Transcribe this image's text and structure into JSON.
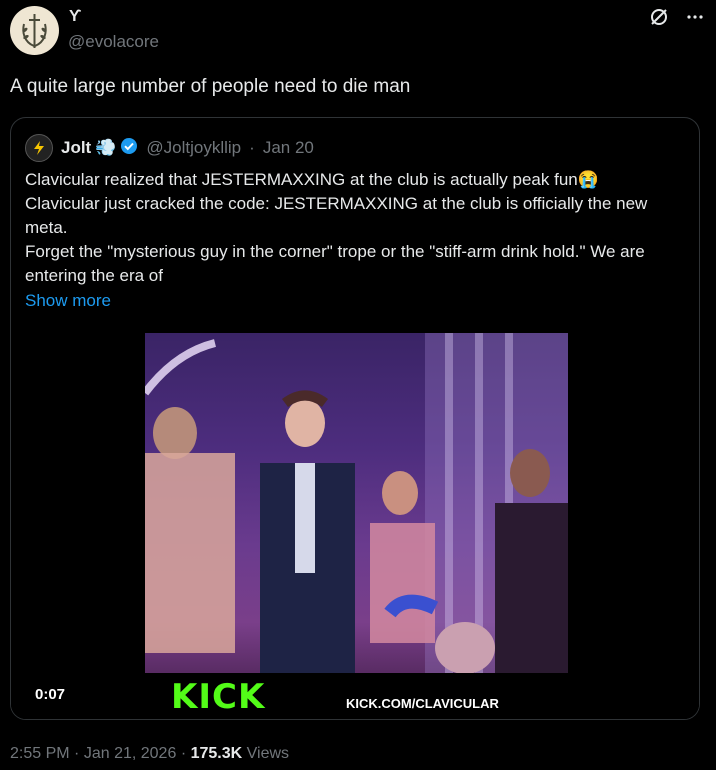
{
  "author": {
    "display_name": "ϒ",
    "handle": "@evolacore",
    "avatar_icon": "laurel-sword-icon"
  },
  "tweet": {
    "text": "A quite large number of people need to die man"
  },
  "quote": {
    "name": "Jolt",
    "name_emoji": "💨",
    "verified_icon": "verified-badge-icon",
    "handle": "@Joltjoykllip",
    "sep": "·",
    "date": "Jan 20",
    "body_lines": [
      "Clavicular realized that JESTERMAXXING at the club is actually peak fun😭",
      "Clavicular just cracked the code: JESTERMAXXING at the club is officially the new meta.",
      "Forget the \"mysterious guy in the corner\" trope or the \"stiff-arm drink hold.\" We are entering the era of"
    ],
    "show_more": "Show more",
    "video": {
      "duration": "0:07",
      "logo": "KICK",
      "url": "KICK.COM/CLAVICULAR"
    }
  },
  "footer": {
    "time": "2:55 PM",
    "dot1": "·",
    "date": "Jan 21, 2026",
    "dot2": "·",
    "views_count": "175.3K",
    "views_label": "Views"
  },
  "colors": {
    "link": "#1d9bf0",
    "muted": "#71767b",
    "kick_green": "#53fc18"
  }
}
